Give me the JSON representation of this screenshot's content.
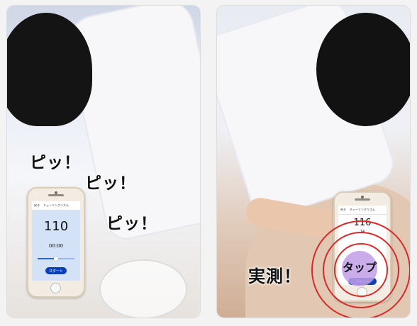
{
  "left_panel": {
    "sound_effects": [
      "ピッ！",
      "ピッ！",
      "ピッ！"
    ],
    "app": {
      "back_label": "戻る",
      "title": "チェーリングリズム",
      "rate": "110",
      "timer": "00:00",
      "slider_value": 0.5,
      "start_button": "スタート"
    }
  },
  "right_panel": {
    "caption": "実測！",
    "app": {
      "back_label": "戻る",
      "title": "チェーリングリズム",
      "rate": "116",
      "count": "14",
      "tap_label": "タップ",
      "reset_button": "リセット"
    }
  },
  "colors": {
    "accent_button": "#0a40b4",
    "screen_background": "#d3e2f7",
    "ripple": "#d52b2b",
    "tap_circle": "#c29ee6"
  }
}
